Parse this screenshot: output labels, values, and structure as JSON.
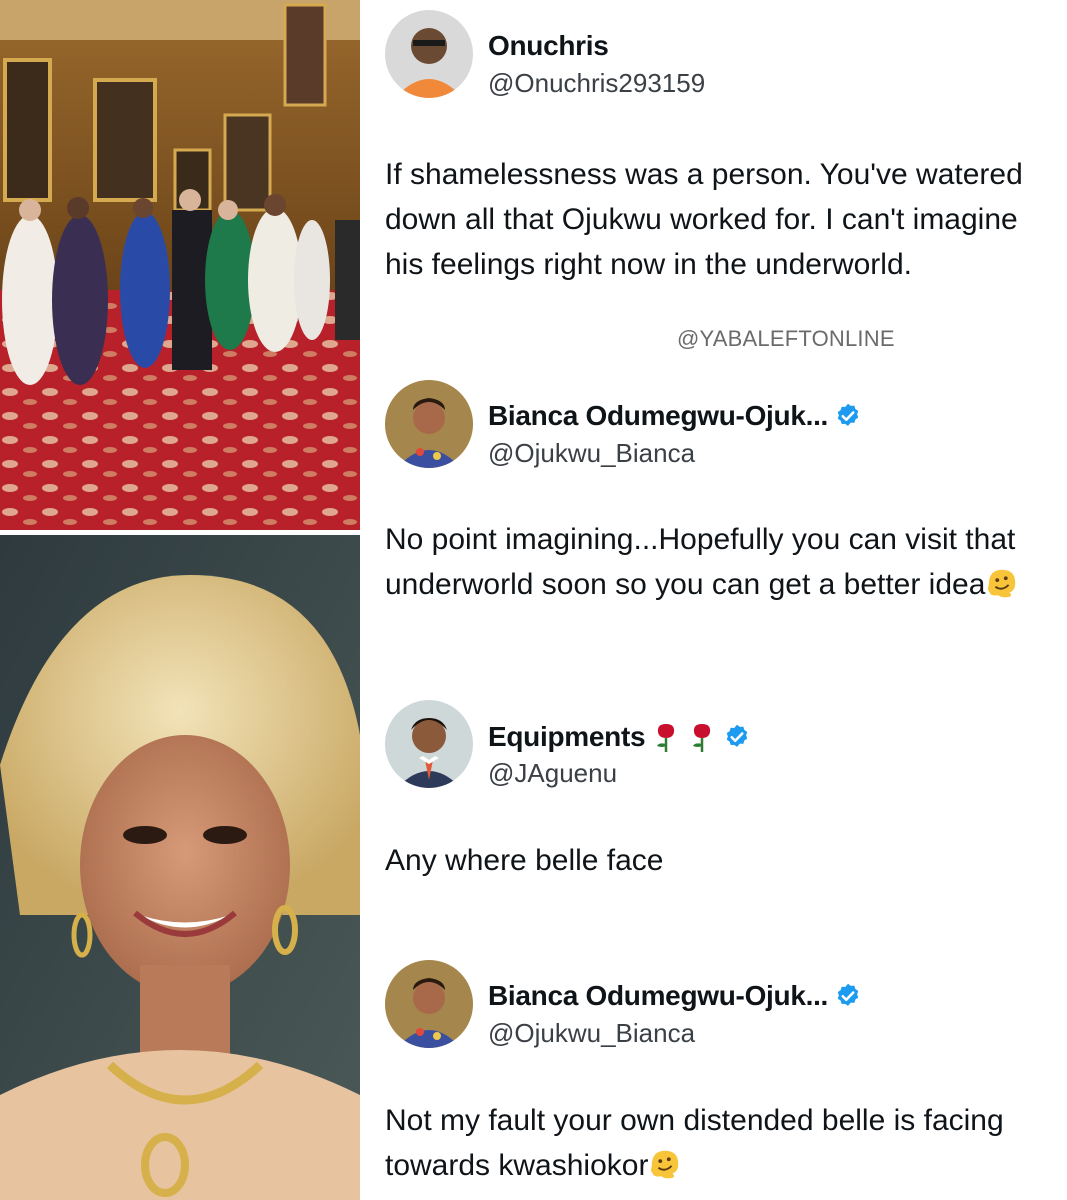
{
  "tweets": [
    {
      "name": "Onuchris",
      "handle": "@Onuchris293159",
      "verified": false,
      "text": "If shamelessness was a person. You've watered down all that Ojukwu worked for. I can't imagine his feelings right now in the underworld."
    },
    {
      "name": "Bianca Odumegwu-Ojuk...",
      "handle": "@Ojukwu_Bianca",
      "verified": true,
      "text": "No point imagining...Hopefully you can visit that underworld soon so you can get a better idea",
      "emoji": "melting-face-emoji"
    },
    {
      "name": "Equipments",
      "handle": "@JAguenu",
      "verified": true,
      "name_emoji": [
        "rose-emoji",
        "rose-emoji"
      ],
      "text": "Any where belle face"
    },
    {
      "name": "Bianca Odumegwu-Ojuk...",
      "handle": "@Ojukwu_Bianca",
      "verified": true,
      "text": "Not my fault your own distended belle is facing towards kwashiokor",
      "emoji": "melting-face-emoji"
    }
  ],
  "watermark": "@YABALEFTONLINE",
  "colors": {
    "verified": "#1d9bf0",
    "text": "#0f1419",
    "handle": "#3b4046"
  }
}
